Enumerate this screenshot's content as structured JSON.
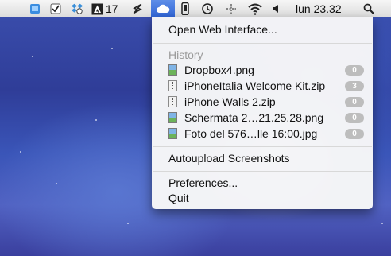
{
  "menubar": {
    "adobe_badge": "17",
    "clock": "lun 23.32",
    "icons": [
      "finder-icon",
      "checklist-icon",
      "dropbox-gear-icon",
      "adobe-icon",
      "lightning-icon",
      "dropbox-cloud-icon",
      "phone-icon",
      "time-machine-icon",
      "network-icon",
      "wifi-icon",
      "volume-icon",
      "spotlight-icon"
    ]
  },
  "menu": {
    "open_web": "Open Web Interface...",
    "history_header": "History",
    "history": [
      {
        "name": "Dropbox4.png",
        "type": "png",
        "count": "0"
      },
      {
        "name": "iPhoneItalia Welcome Kit.zip",
        "type": "zip",
        "count": "3"
      },
      {
        "name": "iPhone Walls 2.zip",
        "type": "zip",
        "count": "0"
      },
      {
        "name": "Schermata 2…21.25.28.png",
        "type": "png",
        "count": "0"
      },
      {
        "name": "Foto del 576…lle 16:00.jpg",
        "type": "png",
        "count": "0"
      }
    ],
    "autoupload": "Autoupload Screenshots",
    "preferences": "Preferences...",
    "quit": "Quit"
  },
  "colors": {
    "menubar_highlight": "#3b6fdc",
    "badge_bg": "#bdbdbd",
    "desktop": "#3a4fb0"
  }
}
